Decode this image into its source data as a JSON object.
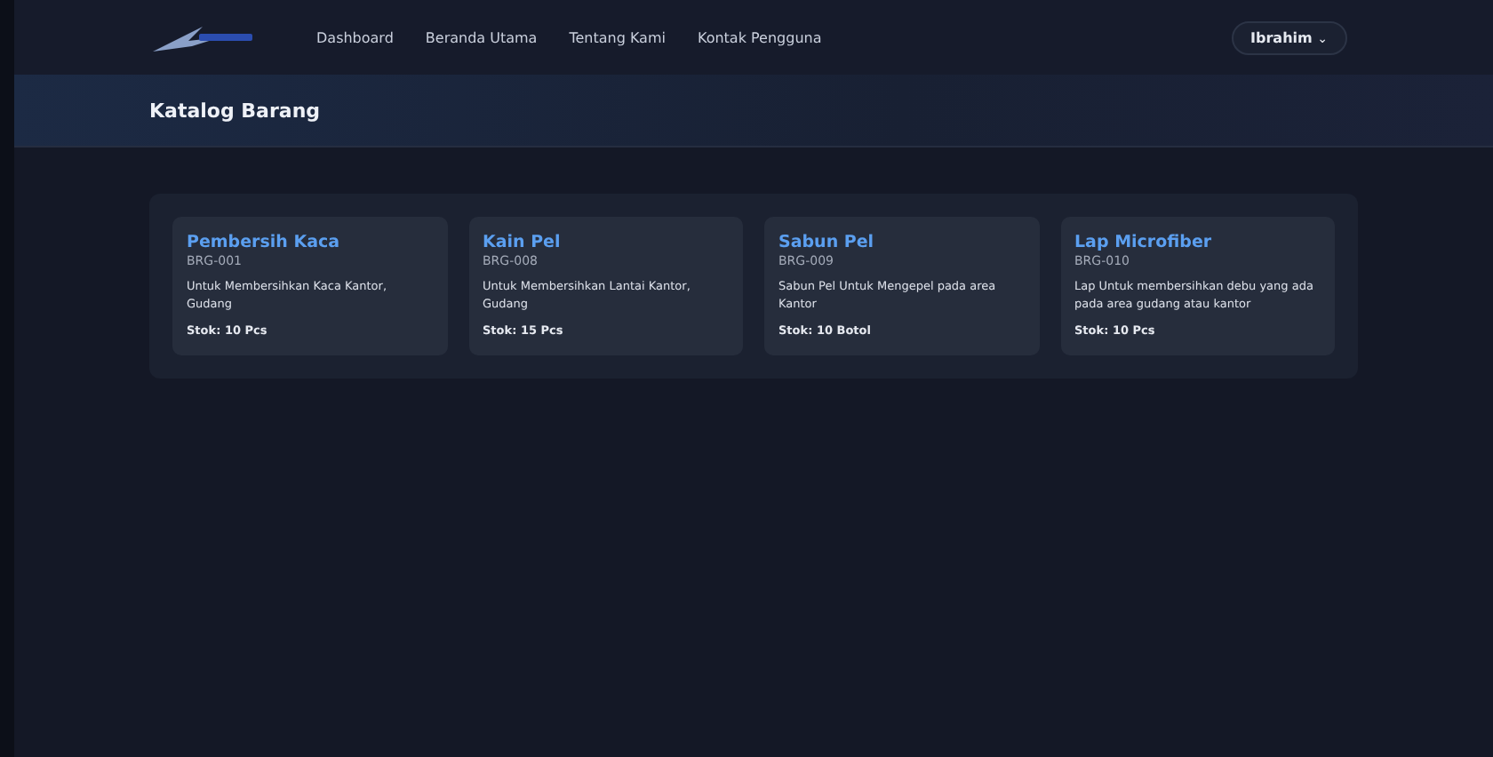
{
  "nav": {
    "links": [
      {
        "label": "Dashboard"
      },
      {
        "label": "Beranda Utama"
      },
      {
        "label": "Tentang Kami"
      },
      {
        "label": "Kontak Pengguna"
      }
    ],
    "user": {
      "name": "Ibrahim",
      "caret": "⌄"
    }
  },
  "header": {
    "title": "Katalog Barang"
  },
  "items": [
    {
      "name": "Pembersih Kaca",
      "code": "BRG-001",
      "description": "Untuk Membersihkan Kaca Kantor, Gudang",
      "stock": "Stok: 10 Pcs"
    },
    {
      "name": "Kain Pel",
      "code": "BRG-008",
      "description": "Untuk Membersihkan Lantai Kantor, Gudang",
      "stock": "Stok: 15 Pcs"
    },
    {
      "name": "Sabun Pel",
      "code": "BRG-009",
      "description": "Sabun Pel Untuk Mengepel pada area Kantor",
      "stock": "Stok: 10 Botol"
    },
    {
      "name": "Lap Microfiber",
      "code": "BRG-010",
      "description": "Lap Untuk membersihkan debu yang ada pada area gudang atau kantor",
      "stock": "Stok: 10 Pcs"
    }
  ]
}
